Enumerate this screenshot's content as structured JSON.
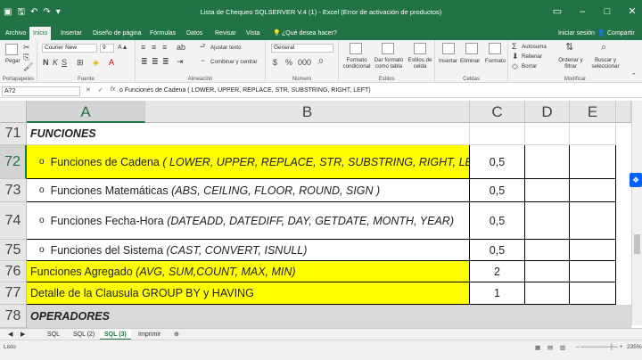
{
  "window": {
    "title": "Lista de Chequeo SQLSERVER V.4 (1) - Excel (Error de activación de productos)"
  },
  "ribbon_tabs": [
    "Archivo",
    "Inicio",
    "Insertar",
    "Diseño de página",
    "Fórmulas",
    "Datos",
    "Revisar",
    "Vista"
  ],
  "tell_me": "¿Qué desea hacer?",
  "account": {
    "signin": "Iniciar sesión",
    "share": "Compartir"
  },
  "ribbon": {
    "paste": "Pegar",
    "clipboard": "Portapapeles",
    "font_name": "Courier New",
    "font_size": "9",
    "font_group": "Fuente",
    "wrap_text": "Ajustar texto",
    "merge_center": "Combinar y centrar",
    "alignment_group": "Alineación",
    "number_format": "General",
    "number_group": "Número",
    "cond_format": "Formato condicional",
    "format_table": "Dar formato como tabla",
    "cell_styles": "Estilos de celda",
    "styles_group": "Estilos",
    "insert": "Insertar",
    "delete": "Eliminar",
    "format": "Formato",
    "cells_group": "Celdas",
    "autosum": "Autosuma",
    "fill": "Rellenar",
    "clear": "Borrar",
    "sort_filter": "Ordenar y filtrar",
    "find_select": "Buscar y seleccionar",
    "editing_group": "Modificar"
  },
  "formula_bar": {
    "name_box": "A72",
    "formula": "o  Funciones de Cadena ( LOWER, UPPER, REPLACE, STR, SUBSTRING, RIGHT, LEFT)"
  },
  "columns": [
    "A",
    "B",
    "C",
    "D",
    "E"
  ],
  "rows": [
    {
      "num": "71",
      "label": "FUNCIONES",
      "value": ""
    },
    {
      "num": "72",
      "label": "Funciones de Cadena",
      "detail": "( LOWER, UPPER, REPLACE, STR, SUBSTRING, RIGHT, LEFT)",
      "value": "0,5"
    },
    {
      "num": "73",
      "label": "Funciones Matemáticas",
      "detail": "(ABS, CEILING, FLOOR,  ROUND, SIGN )",
      "value": "0,5"
    },
    {
      "num": "74",
      "label": "Funciones Fecha-Hora",
      "detail": "(DATEADD, DATEDIFF, DAY, GETDATE, MONTH, YEAR)",
      "value": "0,5"
    },
    {
      "num": "75",
      "label": "Funciones del Sistema",
      "detail": "(CAST, CONVERT, ISNULL)",
      "value": "0,5"
    },
    {
      "num": "76",
      "label": "Funciones Agregado",
      "detail": "(AVG, SUM,COUNT, MAX, MIN)",
      "value": "2"
    },
    {
      "num": "77",
      "label": "Detalle de la Clausula GROUP BY y HAVING",
      "value": "1"
    },
    {
      "num": "78",
      "label": "OPERADORES",
      "value": ""
    }
  ],
  "bullet": "o",
  "sheets": [
    "SQL",
    "SQL (2)",
    "SQL (3)",
    "Imprimir"
  ],
  "status": {
    "ready": "Listo",
    "zoom": "235%"
  }
}
